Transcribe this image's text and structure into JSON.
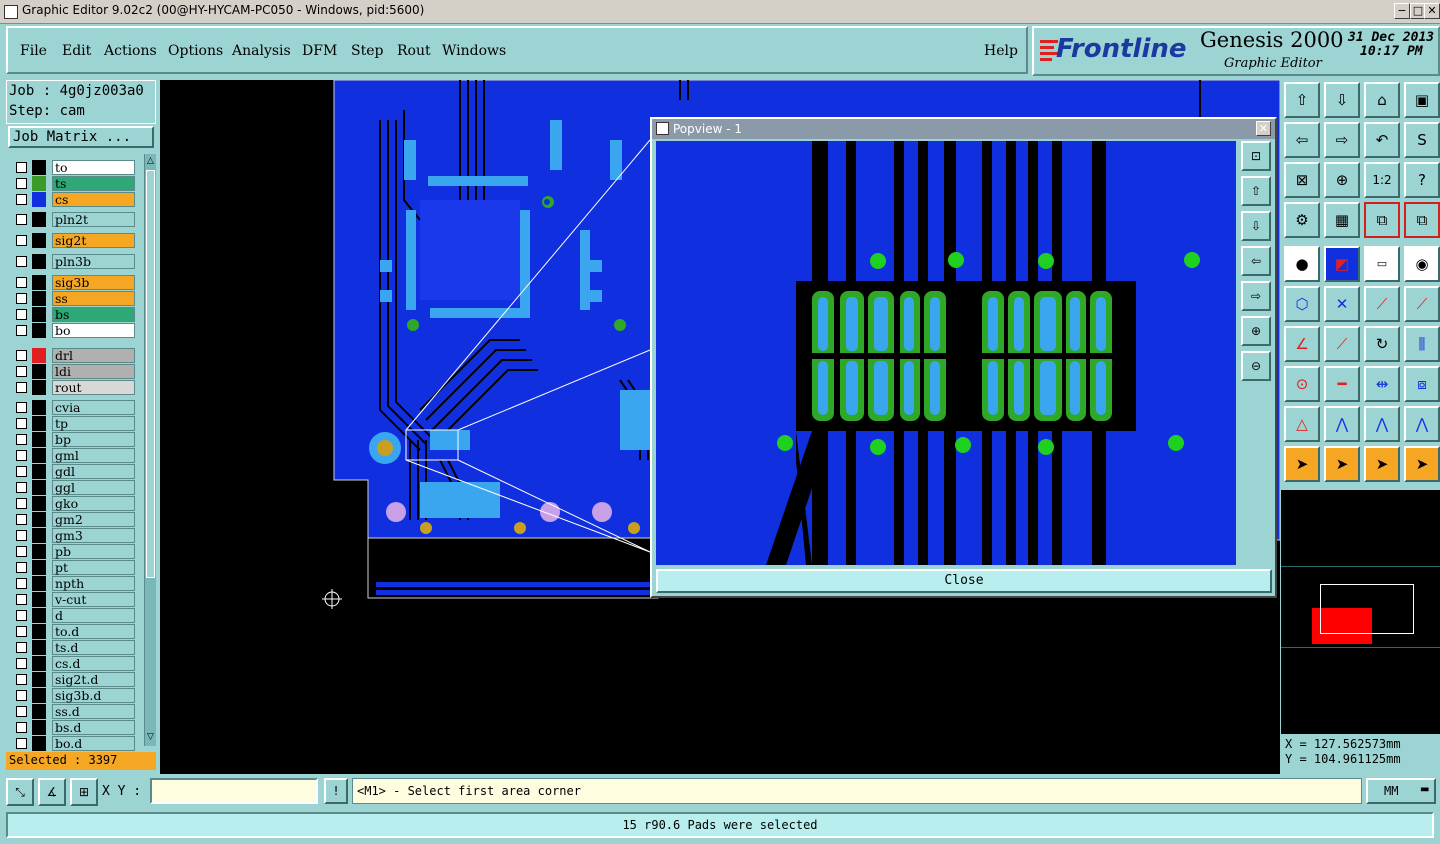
{
  "window": {
    "title": "Graphic Editor 9.02c2 (00@HY-HYCAM-PC050 - Windows, pid:5600)",
    "controls": [
      "−",
      "□",
      "✕"
    ]
  },
  "menubar": {
    "items": [
      "File",
      "Edit",
      "Actions",
      "Options",
      "Analysis",
      "DFM",
      "Step",
      "Rout",
      "Windows"
    ],
    "help": "Help"
  },
  "branding": {
    "logo": "Frontline",
    "product": "Genesis 2000",
    "subtitle": "Graphic Editor",
    "date": "31 Dec 2013",
    "time": "10:17 PM"
  },
  "job": {
    "job_label": "Job : 4g0jz003a0",
    "step_label": "Step: cam",
    "matrix_button": "Job Matrix ..."
  },
  "layers": [
    {
      "name": "to",
      "color": "#ffffff",
      "swatch": "#000000"
    },
    {
      "name": "ts",
      "color": "#2fa878",
      "swatch": "#3a9a2a"
    },
    {
      "name": "cs",
      "color": "#f5a623",
      "swatch": "#1030e0"
    },
    {
      "name": "pln2t",
      "color": "#9cd3d3",
      "swatch": "#000000"
    },
    {
      "name": "sig2t",
      "color": "#f5a623",
      "swatch": "#000000"
    },
    {
      "name": "pln3b",
      "color": "#9cd3d3",
      "swatch": "#000000"
    },
    {
      "name": "sig3b",
      "color": "#f5a623",
      "swatch": "#000000"
    },
    {
      "name": "ss",
      "color": "#f5a623",
      "swatch": "#000000"
    },
    {
      "name": "bs",
      "color": "#2fa878",
      "swatch": "#000000"
    },
    {
      "name": "bo",
      "color": "#ffffff",
      "swatch": "#000000"
    },
    {
      "name": "drl",
      "color": "#b0b0b0",
      "swatch": "#e02020"
    },
    {
      "name": "ldi",
      "color": "#b0b0b0",
      "swatch": "#000000"
    },
    {
      "name": "rout",
      "color": "#d8d8d8",
      "swatch": "#000000"
    },
    {
      "name": "cvia",
      "color": "#9cd3d3",
      "swatch": "#000000"
    },
    {
      "name": "tp",
      "color": "#9cd3d3",
      "swatch": "#000000"
    },
    {
      "name": "bp",
      "color": "#9cd3d3",
      "swatch": "#000000"
    },
    {
      "name": "gml",
      "color": "#9cd3d3",
      "swatch": "#000000"
    },
    {
      "name": "gdl",
      "color": "#9cd3d3",
      "swatch": "#000000"
    },
    {
      "name": "ggl",
      "color": "#9cd3d3",
      "swatch": "#000000"
    },
    {
      "name": "gko",
      "color": "#9cd3d3",
      "swatch": "#000000"
    },
    {
      "name": "gm2",
      "color": "#9cd3d3",
      "swatch": "#000000"
    },
    {
      "name": "gm3",
      "color": "#9cd3d3",
      "swatch": "#000000"
    },
    {
      "name": "pb",
      "color": "#9cd3d3",
      "swatch": "#000000"
    },
    {
      "name": "pt",
      "color": "#9cd3d3",
      "swatch": "#000000"
    },
    {
      "name": "npth",
      "color": "#9cd3d3",
      "swatch": "#000000"
    },
    {
      "name": "v-cut",
      "color": "#9cd3d3",
      "swatch": "#000000"
    },
    {
      "name": "d",
      "color": "#9cd3d3",
      "swatch": "#000000"
    },
    {
      "name": "to.d",
      "color": "#9cd3d3",
      "swatch": "#000000"
    },
    {
      "name": "ts.d",
      "color": "#9cd3d3",
      "swatch": "#000000"
    },
    {
      "name": "cs.d",
      "color": "#9cd3d3",
      "swatch": "#000000"
    },
    {
      "name": "sig2t.d",
      "color": "#9cd3d3",
      "swatch": "#000000"
    },
    {
      "name": "sig3b.d",
      "color": "#9cd3d3",
      "swatch": "#000000"
    },
    {
      "name": "ss.d",
      "color": "#9cd3d3",
      "swatch": "#000000"
    },
    {
      "name": "bs.d",
      "color": "#9cd3d3",
      "swatch": "#000000"
    },
    {
      "name": "bo.d",
      "color": "#9cd3d3",
      "swatch": "#000000"
    }
  ],
  "selected": "Selected : 3397",
  "popview": {
    "title": "Popview - 1",
    "close": "Close"
  },
  "coords": {
    "x": "X = 127.562573mm",
    "y": "Y = 104.961125mm"
  },
  "xy_input": {
    "label": "X Y :",
    "value": ""
  },
  "prompt": "<M1> - Select first area corner",
  "units": "MM",
  "message": "15 r90.6 Pads were selected",
  "colors": {
    "board_blue": "#1030e0",
    "pad_green": "#2fa828",
    "pad_cyan": "#3aa6f0",
    "panel_teal": "#9cd3d3",
    "accent_orange": "#f5a623"
  }
}
